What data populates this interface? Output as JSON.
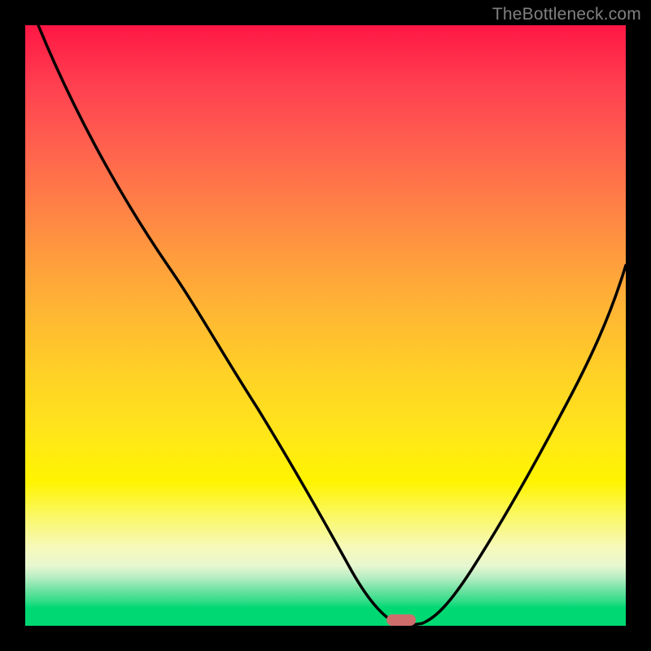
{
  "watermark": "TheBottleneck.com",
  "marker_color": "#cf6d6d",
  "chart_data": {
    "type": "line",
    "title": "",
    "xlabel": "",
    "ylabel": "",
    "x_range_fraction": [
      0,
      1
    ],
    "y_range_fraction": [
      0,
      1
    ],
    "curve_fraction": [
      {
        "x": 0.022,
        "y": 0.0
      },
      {
        "x": 0.09,
        "y": 0.135
      },
      {
        "x": 0.16,
        "y": 0.27
      },
      {
        "x": 0.235,
        "y": 0.395
      },
      {
        "x": 0.305,
        "y": 0.52
      },
      {
        "x": 0.37,
        "y": 0.63
      },
      {
        "x": 0.43,
        "y": 0.73
      },
      {
        "x": 0.49,
        "y": 0.825
      },
      {
        "x": 0.545,
        "y": 0.905
      },
      {
        "x": 0.585,
        "y": 0.96
      },
      {
        "x": 0.615,
        "y": 0.993
      },
      {
        "x": 0.635,
        "y": 1.0
      },
      {
        "x": 0.66,
        "y": 0.993
      },
      {
        "x": 0.695,
        "y": 0.96
      },
      {
        "x": 0.74,
        "y": 0.895
      },
      {
        "x": 0.79,
        "y": 0.81
      },
      {
        "x": 0.845,
        "y": 0.71
      },
      {
        "x": 0.9,
        "y": 0.6
      },
      {
        "x": 0.955,
        "y": 0.485
      },
      {
        "x": 1.0,
        "y": 0.39
      }
    ],
    "background_gradient_stops": [
      {
        "pos": 0.0,
        "color": "#ff1744"
      },
      {
        "pos": 0.5,
        "color": "#ffd126"
      },
      {
        "pos": 0.8,
        "color": "#fff400"
      },
      {
        "pos": 0.97,
        "color": "#00d973"
      }
    ],
    "marker": {
      "x_fraction": 0.625,
      "y_fraction": 1.0,
      "color": "#cf6d6d"
    }
  }
}
